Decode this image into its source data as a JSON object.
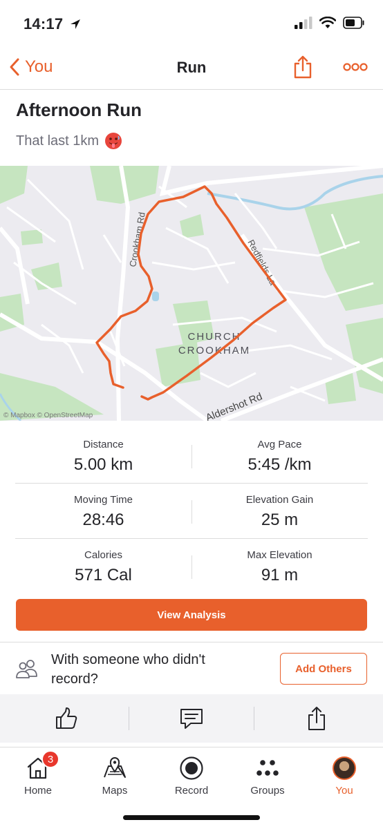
{
  "status_bar": {
    "time": "14:17"
  },
  "nav": {
    "back_label": "You",
    "title": "Run"
  },
  "activity": {
    "title": "Afternoon Run",
    "description": "That last 1km"
  },
  "map": {
    "labels": {
      "crookham_rd": "Crookham Rd",
      "area_line1": "CHURCH",
      "area_line2": "CROOKHAM",
      "aldershot_rd": "Aldershot Rd",
      "east_rd": "Redfields La",
      "attribution": "© Mapbox © OpenStreetMap"
    },
    "route_color": "#E8602C"
  },
  "stats": [
    {
      "label": "Distance",
      "value": "5.00 km"
    },
    {
      "label": "Avg Pace",
      "value": "5:45 /km"
    },
    {
      "label": "Moving Time",
      "value": "28:46"
    },
    {
      "label": "Elevation Gain",
      "value": "25 m"
    },
    {
      "label": "Calories",
      "value": "571 Cal"
    },
    {
      "label": "Max Elevation",
      "value": "91 m"
    }
  ],
  "view_analysis_label": "View Analysis",
  "others": {
    "text": "With someone who didn't record?",
    "add_label": "Add Others"
  },
  "actions": {
    "icons": [
      "thumbs-up-icon",
      "comment-icon",
      "share-icon"
    ]
  },
  "tabbar": {
    "tabs": [
      {
        "label": "Home",
        "badge": "3"
      },
      {
        "label": "Maps"
      },
      {
        "label": "Record"
      },
      {
        "label": "Groups"
      },
      {
        "label": "You",
        "active": true
      }
    ]
  },
  "colors": {
    "accent": "#E8602C",
    "badge": "#E8372C"
  }
}
